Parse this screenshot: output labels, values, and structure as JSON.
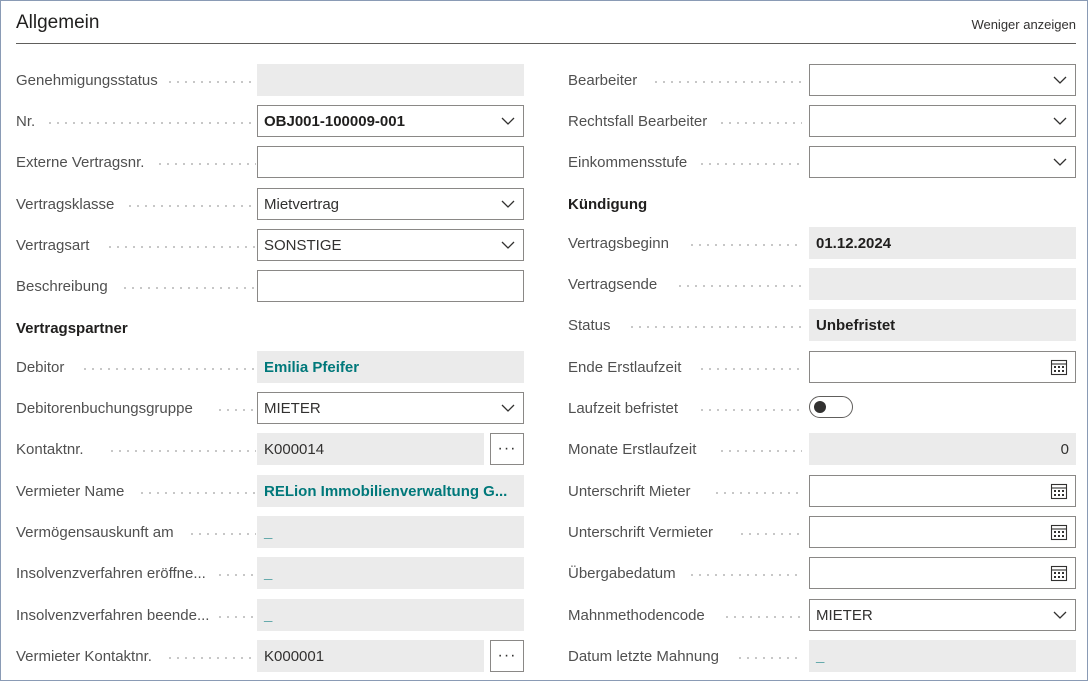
{
  "header": {
    "title": "Allgemein",
    "toggle_label": "Weniger anzeigen"
  },
  "left": {
    "genehmigungsstatus": {
      "label": "Genehmigungsstatus",
      "value": ""
    },
    "nr": {
      "label": "Nr.",
      "value": "OBJ001-100009-001"
    },
    "externe_vertragsnr": {
      "label": "Externe Vertragsnr.",
      "value": ""
    },
    "vertragsklasse": {
      "label": "Vertragsklasse",
      "value": "Mietvertrag"
    },
    "vertragsart": {
      "label": "Vertragsart",
      "value": "SONSTIGE"
    },
    "beschreibung": {
      "label": "Beschreibung",
      "value": ""
    },
    "section_vertragspartner": "Vertragspartner",
    "debitor": {
      "label": "Debitor",
      "value": "Emilia Pfeifer"
    },
    "debitorenbuchungsgruppe": {
      "label": "Debitorenbuchungsgruppe",
      "value": "MIETER"
    },
    "kontaktnr": {
      "label": "Kontaktnr.",
      "value": "K000014",
      "assist": "···"
    },
    "vermieter_name": {
      "label": "Vermieter Name",
      "value": "RELion Immobilienverwaltung G..."
    },
    "vermoegensauskunft": {
      "label": "Vermögensauskunft am",
      "value": "_"
    },
    "insolvenz_eroeffnet": {
      "label": "Insolvenzverfahren eröffne...",
      "value": "_"
    },
    "insolvenz_beendet": {
      "label": "Insolvenzverfahren beende...",
      "value": "_"
    },
    "vermieter_kontaktnr": {
      "label": "Vermieter Kontaktnr.",
      "value": "K000001",
      "assist": "···"
    }
  },
  "right": {
    "bearbeiter": {
      "label": "Bearbeiter",
      "value": ""
    },
    "rechtsfall_bearbeiter": {
      "label": "Rechtsfall Bearbeiter",
      "value": ""
    },
    "einkommensstufe": {
      "label": "Einkommensstufe",
      "value": ""
    },
    "section_kuendigung": "Kündigung",
    "vertragsbeginn": {
      "label": "Vertragsbeginn",
      "value": "01.12.2024"
    },
    "vertragsende": {
      "label": "Vertragsende",
      "value": ""
    },
    "status": {
      "label": "Status",
      "value": "Unbefristet"
    },
    "ende_erstlaufzeit": {
      "label": "Ende Erstlaufzeit",
      "value": ""
    },
    "laufzeit_befristet": {
      "label": "Laufzeit befristet",
      "value": false
    },
    "monate_erstlaufzeit": {
      "label": "Monate Erstlaufzeit",
      "value": "0"
    },
    "unterschrift_mieter": {
      "label": "Unterschrift Mieter",
      "value": ""
    },
    "unterschrift_vermieter": {
      "label": "Unterschrift Vermieter",
      "value": ""
    },
    "uebergabedatum": {
      "label": "Übergabedatum",
      "value": ""
    },
    "mahnmethodencode": {
      "label": "Mahnmethodencode",
      "value": "MIETER"
    },
    "datum_letzte_mahnung": {
      "label": "Datum letzte Mahnung",
      "value": "_"
    }
  },
  "icons": {
    "dropdown": "chevron-down-icon",
    "date": "calendar-icon",
    "assist": "more-options-icon"
  }
}
